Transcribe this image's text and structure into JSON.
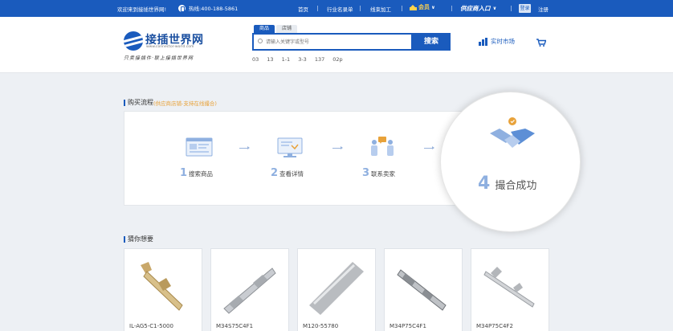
{
  "topbar": {
    "welcome": "欢迎来到接插世界网!",
    "hotline": "热线:400-188-5861",
    "nav": [
      "首页",
      "行业名录单",
      "线束加工"
    ],
    "vip_label": "会员",
    "supplier_label": "供应商入口",
    "login_label": "登录",
    "register_label": "注册"
  },
  "header": {
    "logo_text": "接插世界网",
    "logo_url": "www.connector-world.com",
    "slogan": "只卖接插件·联上接插世界网",
    "search_tabs": [
      "商品",
      "店铺"
    ],
    "search_placeholder": "请输入关键字或型号",
    "search_button": "搜索",
    "hot_keywords": [
      "03",
      "13",
      "1-1",
      "3-3",
      "137",
      "02p"
    ],
    "market_label": "实时市场"
  },
  "process": {
    "title": "购买流程",
    "subtitle": "(供应商店铺-支持在线撮合)",
    "steps": [
      {
        "num": "1",
        "label": "搜索商品"
      },
      {
        "num": "2",
        "label": "查看详情"
      },
      {
        "num": "3",
        "label": "联系卖家"
      },
      {
        "num": "4",
        "label": "撮合成功"
      }
    ]
  },
  "recommend": {
    "title": "猜你想要",
    "products": [
      {
        "name": "IL-AG5-C1-5000"
      },
      {
        "name": "M34S75C4F1"
      },
      {
        "name": "M120-55780"
      },
      {
        "name": "M34P75C4F1"
      },
      {
        "name": "M34P75C4F2"
      }
    ]
  },
  "colors": {
    "brand": "#1a5bbd",
    "vip": "#ffd34d",
    "accent_orange": "#e8a23a"
  }
}
